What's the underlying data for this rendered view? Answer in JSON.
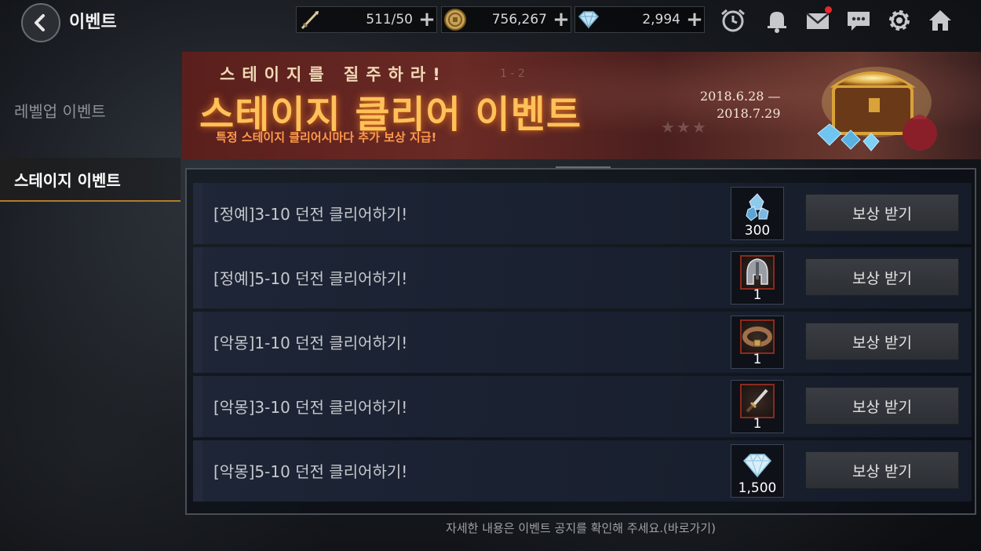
{
  "header": {
    "title": "이벤트",
    "currencies": [
      {
        "icon": "sword-icon",
        "value": "511/50"
      },
      {
        "icon": "gold-coin-icon",
        "value": "756,267"
      },
      {
        "icon": "diamond-icon",
        "value": "2,994"
      }
    ],
    "icons": [
      "clock-icon",
      "bell-icon",
      "mail-icon",
      "chat-icon",
      "gear-icon",
      "home-icon"
    ]
  },
  "sidebar": {
    "items": [
      {
        "label": "레벨업 이벤트",
        "active": false
      },
      {
        "label": "스테이지 이벤트",
        "active": true
      }
    ]
  },
  "banner": {
    "tagline": "스테이지를 질주하라!",
    "title": "스테이지 클리어 이벤트",
    "subtitle": "특정 스테이지 클리어시마다 추가 보상 지급!",
    "date_start": "2018.6.28 —",
    "date_end": "2018.7.29"
  },
  "quests": [
    {
      "label": "[정예]3-10 던전 클리어하기!",
      "reward_icon": "crystal-icon",
      "reward_count": "300",
      "button": "보상 받기"
    },
    {
      "label": "[정예]5-10 던전 클리어하기!",
      "reward_icon": "helmet-icon",
      "reward_count": "1",
      "button": "보상 받기"
    },
    {
      "label": "[악몽]1-10 던전 클리어하기!",
      "reward_icon": "belt-icon",
      "reward_count": "1",
      "button": "보상 받기"
    },
    {
      "label": "[악몽]3-10 던전 클리어하기!",
      "reward_icon": "dagger-icon",
      "reward_count": "1",
      "button": "보상 받기"
    },
    {
      "label": "[악몽]5-10 던전 클리어하기!",
      "reward_icon": "diamond-icon",
      "reward_count": "1,500",
      "button": "보상 받기"
    }
  ],
  "footer": {
    "note": "자세한 내용은 이벤트 공지를 확인해 주세요.(바로가기)"
  }
}
